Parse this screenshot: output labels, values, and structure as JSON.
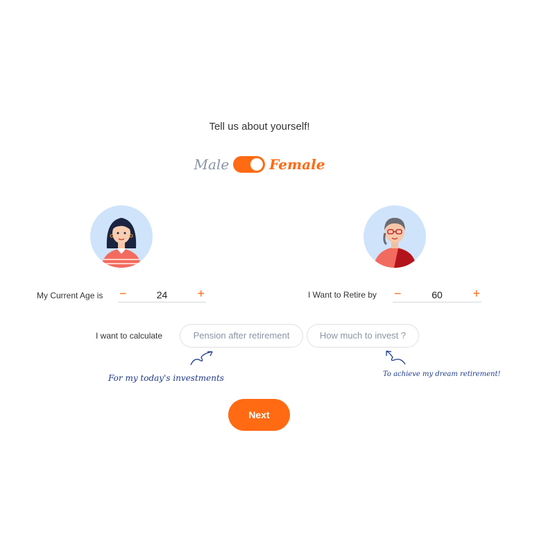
{
  "header": {
    "title": "Tell us about yourself!"
  },
  "gender": {
    "male_label": "Male",
    "female_label": "Female",
    "selected": "Female"
  },
  "current_age": {
    "label": "My Current Age is",
    "value": "24",
    "minus": "−",
    "plus": "+"
  },
  "retire_age": {
    "label": "I Want to Retire by",
    "value": "60",
    "minus": "−",
    "plus": "+"
  },
  "calculate": {
    "label": "I want to calculate",
    "options": [
      "Pension after retirement",
      "How much to invest ?"
    ],
    "notes": [
      "For my today's investments",
      "To achieve my dream retirement!"
    ]
  },
  "actions": {
    "next_label": "Next"
  },
  "colors": {
    "accent": "#ff6a13",
    "avatar_bg": "#cfe3fb",
    "note_ink": "#1e3a8a"
  }
}
